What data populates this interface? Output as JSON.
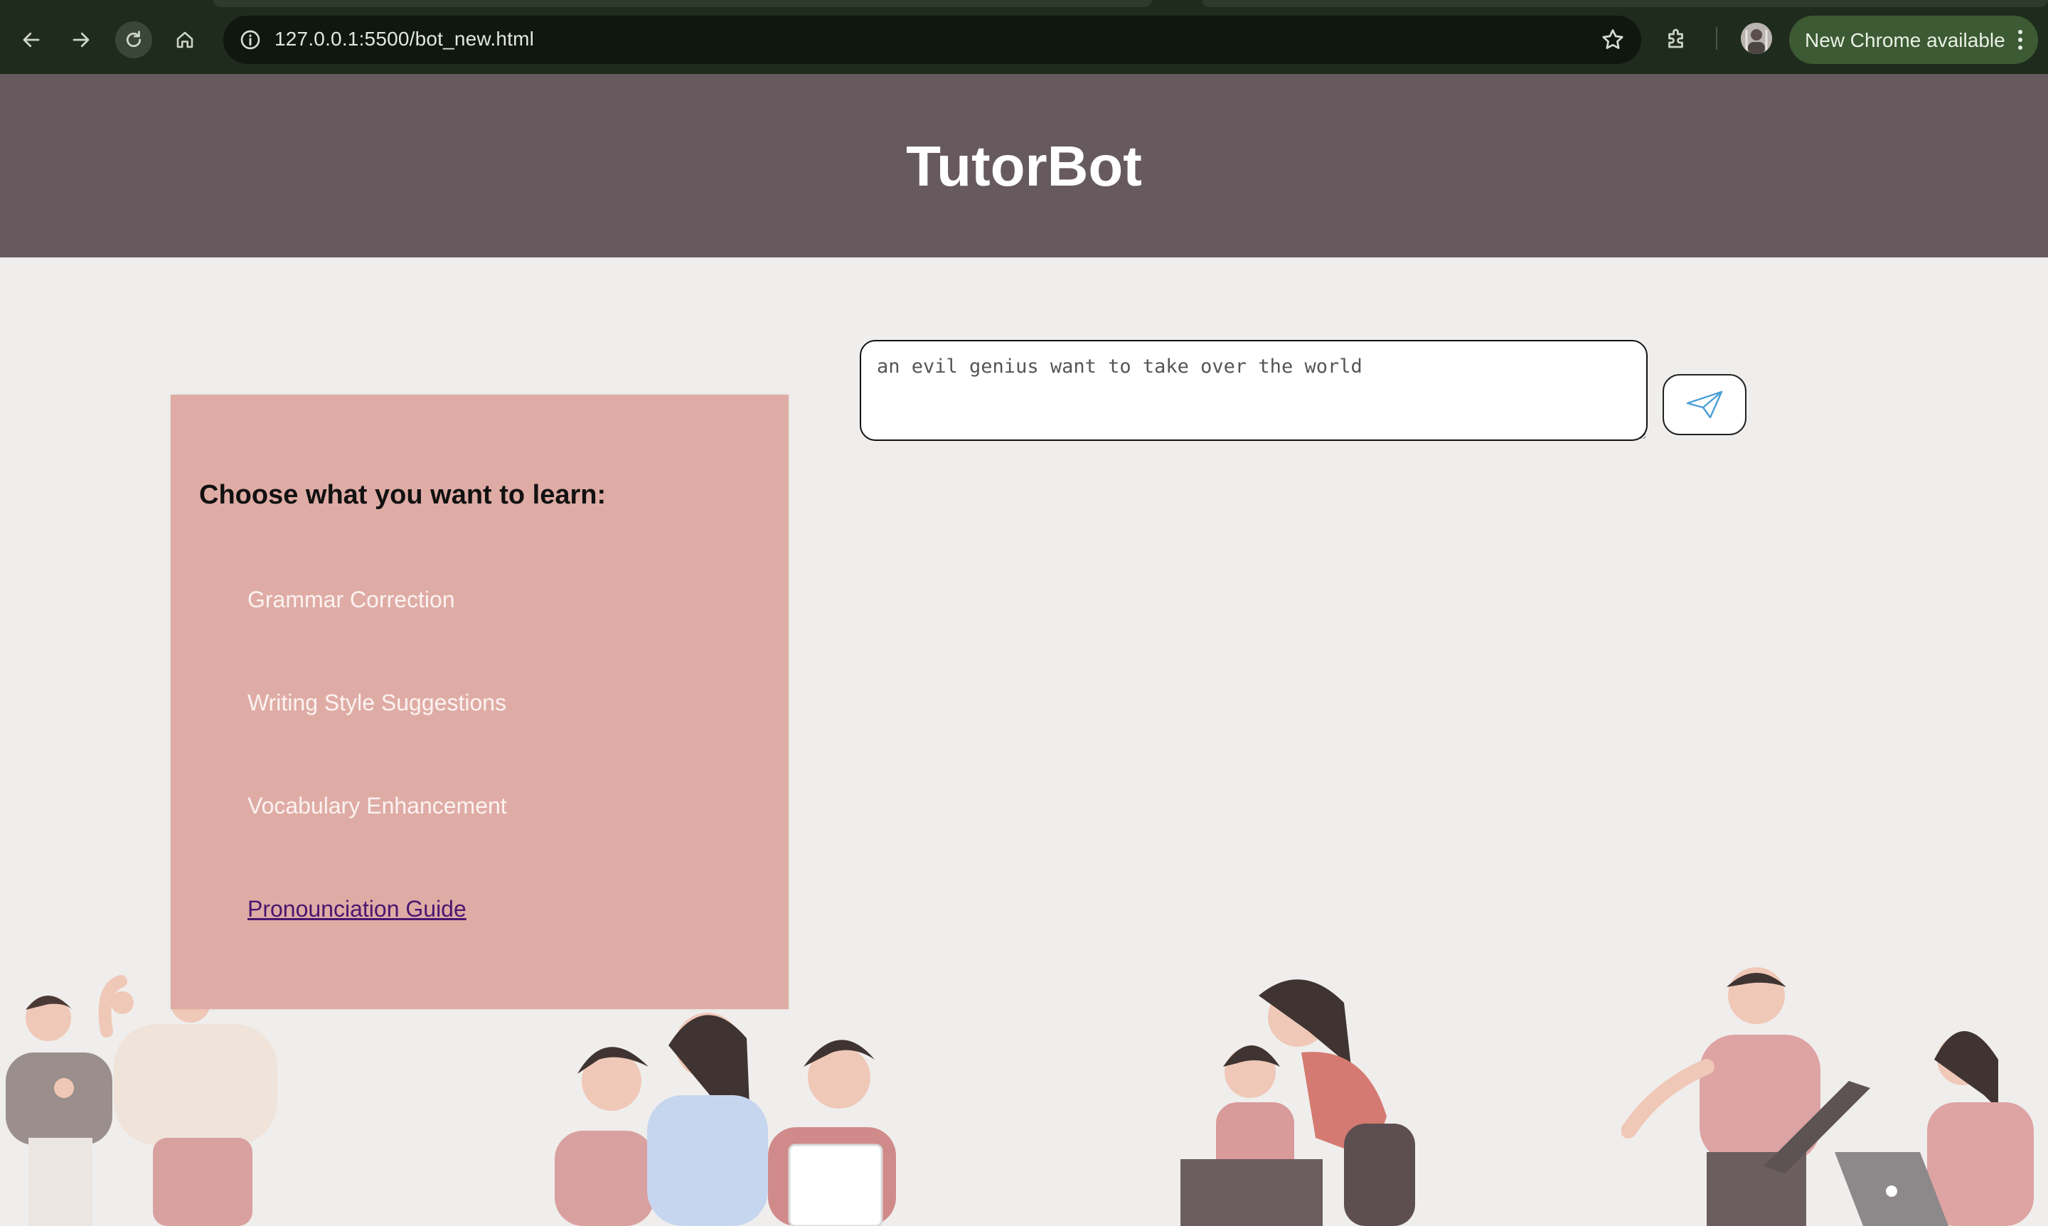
{
  "browser": {
    "url": "127.0.0.1:5500/bot_new.html",
    "update_label": "New Chrome available",
    "icons": {
      "back": "arrow-left-icon",
      "forward": "arrow-right-icon",
      "reload": "reload-icon",
      "home": "home-icon",
      "site_info": "info-icon",
      "bookmark": "star-icon",
      "extensions": "puzzle-icon",
      "menu": "kebab-icon"
    }
  },
  "header": {
    "title": "TutorBot"
  },
  "learn_panel": {
    "heading": "Choose what you want to learn:",
    "items": [
      {
        "label": "Grammar Correction"
      },
      {
        "label": "Writing Style Suggestions"
      },
      {
        "label": "Vocabulary Enhancement"
      },
      {
        "label": "Pronounciation Guide"
      }
    ]
  },
  "chat": {
    "input_value": "an evil genius want to take over the world",
    "send_icon": "paper-plane-icon"
  },
  "colors": {
    "header_bg": "#675a5f",
    "panel_bg": "#dfaca5",
    "page_bg": "#efeeec",
    "visited_link": "#4a1670",
    "send_icon": "#4a9fd6"
  }
}
